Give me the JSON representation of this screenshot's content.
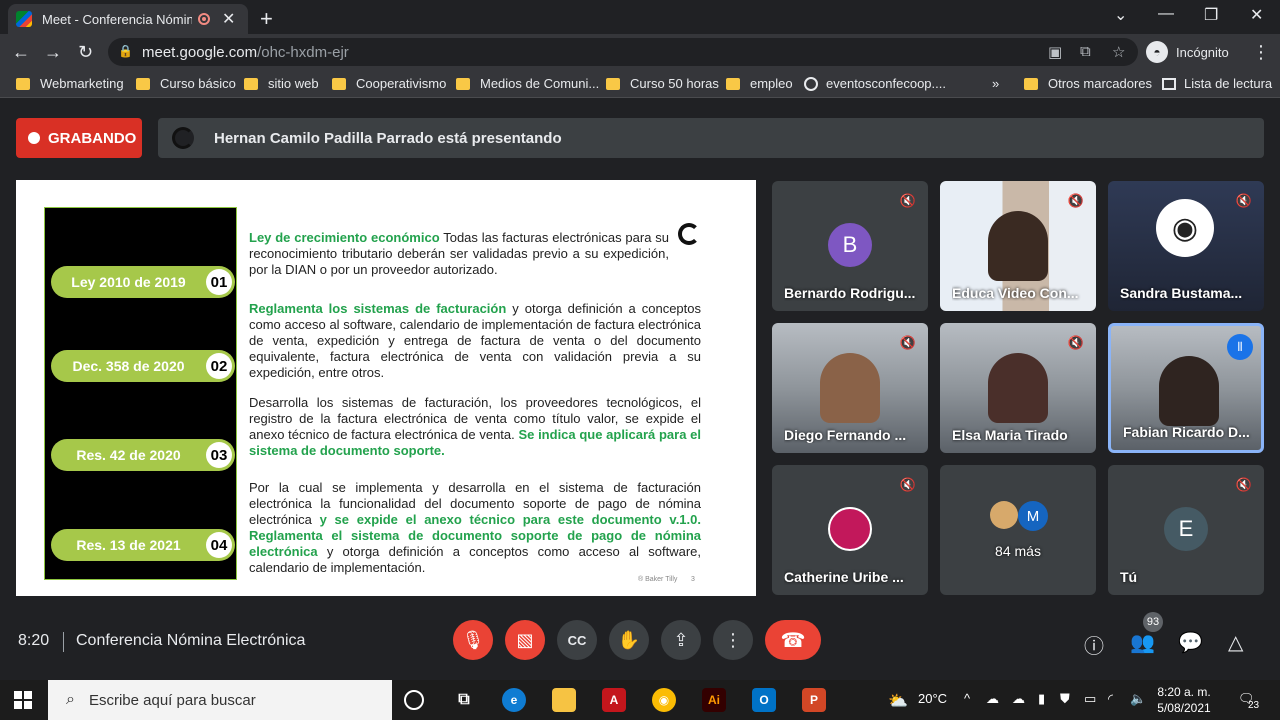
{
  "browser": {
    "tab_title": "Meet - Conferencia Nómina Ele",
    "url_host": "meet.google.com",
    "url_path": "/ohc-hxdm-ejr",
    "incognito_label": "Incógnito"
  },
  "bookmarks": {
    "items": [
      "Webmarketing",
      "Curso básico",
      "sitio web",
      "Cooperativismo",
      "Medios de Comuni...",
      "Curso 50 horas",
      "empleo",
      "eventosconfecoop...."
    ],
    "more": "»",
    "other": "Otros marcadores",
    "reading_list": "Lista de lectura"
  },
  "meet": {
    "recording_label": "GRABANDO",
    "presenting_text": "Hernan Camilo Padilla Parrado está presentando",
    "time": "8:20",
    "meeting_title": "Conferencia Nómina Electrónica",
    "participants_count": "93"
  },
  "slide": {
    "pills": [
      {
        "label": "Ley 2010 de 2019",
        "num": "01"
      },
      {
        "label": "Dec. 358 de 2020",
        "num": "02"
      },
      {
        "label": "Res. 42 de 2020",
        "num": "03"
      },
      {
        "label": "Res. 13 de 2021",
        "num": "04"
      }
    ],
    "p1_green": "Ley de crecimiento económico",
    "p1_text": " Todas las facturas electrónicas para su reconocimiento tributario deberán ser validadas previo a su expedición, por la DIAN o por un proveedor autorizado.",
    "p2_green": "Reglamenta los sistemas de facturación",
    "p2_text": " y otorga definición a conceptos como acceso al software, calendario de implementación de factura electrónica de venta, expedición y entrega de factura de venta o del documento equivalente, factura electrónica de venta con validación previa a su expedición, entre otros.",
    "p3_text": "Desarrolla los sistemas de facturación, los proveedores tecnológicos, el registro de la factura electrónica de venta como título valor, se expide el anexo técnico de factura electrónica de venta. ",
    "p3_green": "Se indica que aplicará para el sistema de documento soporte.",
    "p4_text": "Por la cual se implementa y desarrolla en el sistema de facturación electrónica la funcionalidad del documento soporte de pago de nómina electrónica ",
    "p4_green": "y se expide el anexo técnico para este documento v.1.0. Reglamenta el sistema de documento soporte de pago de nómina electrónica",
    "p4_tail": " y otorga definición a conceptos como acceso al software, calendario de implementación.",
    "footer": "® Baker Tilly",
    "page": "3"
  },
  "tiles": [
    {
      "name": "Bernardo Rodrigu...",
      "initial": "B",
      "color": "#7e57c2"
    },
    {
      "name": "Educa Video Con..."
    },
    {
      "name": "Sandra Bustama..."
    },
    {
      "name": "Diego Fernando ..."
    },
    {
      "name": "Elsa Maria Tirado"
    },
    {
      "name": "Fabian Ricardo D..."
    },
    {
      "name": "Catherine Uribe ..."
    },
    {
      "name": "84 más",
      "initial": "M"
    },
    {
      "name": "Tú",
      "initial": "E",
      "color": "#455a64"
    }
  ],
  "taskbar": {
    "search_placeholder": "Escribe aquí para buscar",
    "temperature": "20°C",
    "clock_time": "8:20 a. m.",
    "clock_date": "5/08/2021",
    "notifications": "23"
  }
}
